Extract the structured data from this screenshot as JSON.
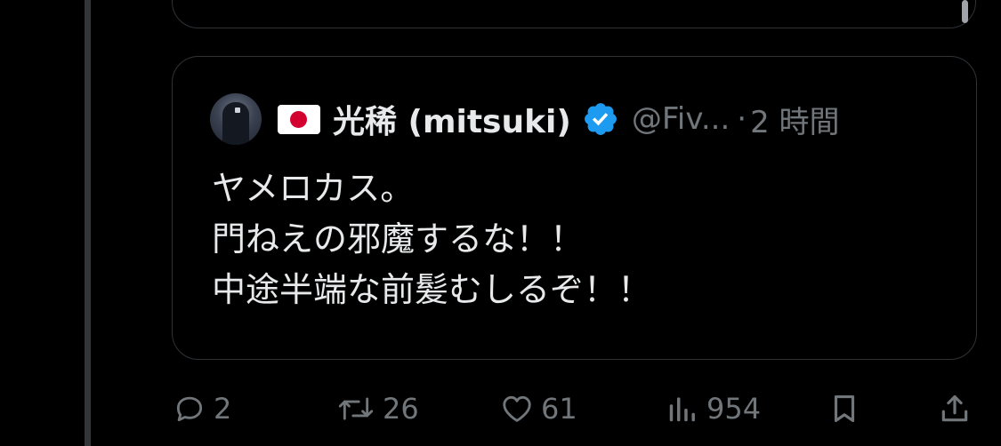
{
  "quoted_post": {
    "flag": "🇯🇵",
    "display_name": "光稀 (mitsuki)",
    "handle": "@Fiv...",
    "separator": "·",
    "time": "2 時間",
    "lines": [
      "ヤメロカス。",
      "門ねえの邪魔するな！！",
      "中途半端な前髪むしるぞ！！"
    ]
  },
  "actions": {
    "reply_count": "2",
    "repost_count": "26",
    "like_count": "61",
    "view_count": "954"
  },
  "colors": {
    "background": "#000000",
    "text": "#e7e9ea",
    "secondary": "#71767b",
    "border": "#2f3336",
    "verified": "#1d9bf0"
  }
}
